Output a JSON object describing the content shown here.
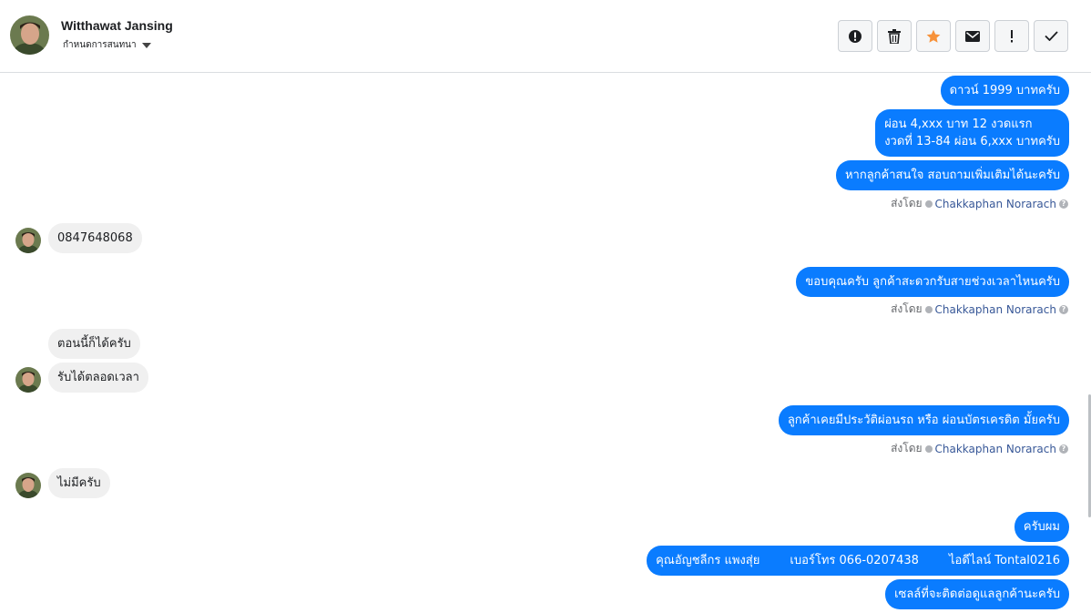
{
  "header": {
    "contact_name": "Witthawat Jansing",
    "assign_label": "กำหนดการสนทนา",
    "actions": [
      {
        "name": "spam-icon"
      },
      {
        "name": "trash-icon"
      },
      {
        "name": "star-icon",
        "color": "#f7923a"
      },
      {
        "name": "mail-icon"
      },
      {
        "name": "important-icon"
      },
      {
        "name": "check-icon"
      }
    ]
  },
  "messages": {
    "m1": "ดาวน์ 1999 บาทครับ",
    "m2_line1": "ผ่อน 4,xxx บาท 12 งวดแรก",
    "m2_line2": "งวดที่ 13-84 ผ่อน 6,xxx บาทครับ",
    "m3": "หากลูกค้าสนใจ สอบถามเพิ่มเติมได้นะครับ",
    "m4": "0847648068",
    "m5": "ขอบคุณครับ ลูกค้าสะดวกรับสายช่วงเวลาไหนครับ",
    "m6": "ตอนนี้ก็ได้ครับ",
    "m7": "รับได้ตลอดเวลา",
    "m8": "ลูกค้าเคยมีประวัติผ่อนรถ หรือ ผ่อนบัตรเครดิต มั้ยครับ",
    "m9": "ไม่มีครับ",
    "m10": "ครับผม",
    "m11": "คุณอัญชลีกร แพงสุ่ย        เบอร์โทร 066-0207438        ไอดีไลน์ Tontal0216",
    "m12": "เซลล์ที่จะติดต่อดูแลลูกค้านะครับ"
  },
  "sent_by": {
    "prefix": "ส่งโดย",
    "agent": "Chakkaphan Norarach"
  },
  "colors": {
    "outgoing_bubble": "#0a7cff",
    "incoming_bubble": "#f0f0f0",
    "agent_link": "#385898"
  }
}
